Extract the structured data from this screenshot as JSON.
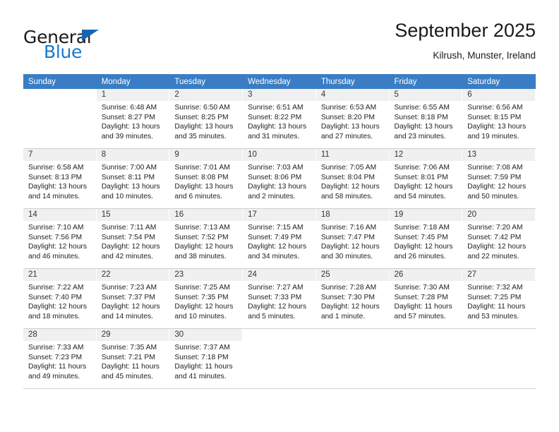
{
  "logo": {
    "word_one": "General",
    "word_two": "Blue",
    "triangle_color": "#1565b0",
    "blue_color": "#1878cf"
  },
  "header": {
    "month_title": "September 2025",
    "location": "Kilrush, Munster, Ireland"
  },
  "calendar": {
    "header_bg": "#3a7dc4",
    "daynum_bg": "#f0f0f0",
    "weekday_headers": [
      "Sunday",
      "Monday",
      "Tuesday",
      "Wednesday",
      "Thursday",
      "Friday",
      "Saturday"
    ],
    "weeks": [
      [
        {
          "day": "",
          "sunrise": "",
          "sunset": "",
          "daylight": ""
        },
        {
          "day": "1",
          "sunrise": "Sunrise: 6:48 AM",
          "sunset": "Sunset: 8:27 PM",
          "daylight": "Daylight: 13 hours and 39 minutes."
        },
        {
          "day": "2",
          "sunrise": "Sunrise: 6:50 AM",
          "sunset": "Sunset: 8:25 PM",
          "daylight": "Daylight: 13 hours and 35 minutes."
        },
        {
          "day": "3",
          "sunrise": "Sunrise: 6:51 AM",
          "sunset": "Sunset: 8:22 PM",
          "daylight": "Daylight: 13 hours and 31 minutes."
        },
        {
          "day": "4",
          "sunrise": "Sunrise: 6:53 AM",
          "sunset": "Sunset: 8:20 PM",
          "daylight": "Daylight: 13 hours and 27 minutes."
        },
        {
          "day": "5",
          "sunrise": "Sunrise: 6:55 AM",
          "sunset": "Sunset: 8:18 PM",
          "daylight": "Daylight: 13 hours and 23 minutes."
        },
        {
          "day": "6",
          "sunrise": "Sunrise: 6:56 AM",
          "sunset": "Sunset: 8:15 PM",
          "daylight": "Daylight: 13 hours and 19 minutes."
        }
      ],
      [
        {
          "day": "7",
          "sunrise": "Sunrise: 6:58 AM",
          "sunset": "Sunset: 8:13 PM",
          "daylight": "Daylight: 13 hours and 14 minutes."
        },
        {
          "day": "8",
          "sunrise": "Sunrise: 7:00 AM",
          "sunset": "Sunset: 8:11 PM",
          "daylight": "Daylight: 13 hours and 10 minutes."
        },
        {
          "day": "9",
          "sunrise": "Sunrise: 7:01 AM",
          "sunset": "Sunset: 8:08 PM",
          "daylight": "Daylight: 13 hours and 6 minutes."
        },
        {
          "day": "10",
          "sunrise": "Sunrise: 7:03 AM",
          "sunset": "Sunset: 8:06 PM",
          "daylight": "Daylight: 13 hours and 2 minutes."
        },
        {
          "day": "11",
          "sunrise": "Sunrise: 7:05 AM",
          "sunset": "Sunset: 8:04 PM",
          "daylight": "Daylight: 12 hours and 58 minutes."
        },
        {
          "day": "12",
          "sunrise": "Sunrise: 7:06 AM",
          "sunset": "Sunset: 8:01 PM",
          "daylight": "Daylight: 12 hours and 54 minutes."
        },
        {
          "day": "13",
          "sunrise": "Sunrise: 7:08 AM",
          "sunset": "Sunset: 7:59 PM",
          "daylight": "Daylight: 12 hours and 50 minutes."
        }
      ],
      [
        {
          "day": "14",
          "sunrise": "Sunrise: 7:10 AM",
          "sunset": "Sunset: 7:56 PM",
          "daylight": "Daylight: 12 hours and 46 minutes."
        },
        {
          "day": "15",
          "sunrise": "Sunrise: 7:11 AM",
          "sunset": "Sunset: 7:54 PM",
          "daylight": "Daylight: 12 hours and 42 minutes."
        },
        {
          "day": "16",
          "sunrise": "Sunrise: 7:13 AM",
          "sunset": "Sunset: 7:52 PM",
          "daylight": "Daylight: 12 hours and 38 minutes."
        },
        {
          "day": "17",
          "sunrise": "Sunrise: 7:15 AM",
          "sunset": "Sunset: 7:49 PM",
          "daylight": "Daylight: 12 hours and 34 minutes."
        },
        {
          "day": "18",
          "sunrise": "Sunrise: 7:16 AM",
          "sunset": "Sunset: 7:47 PM",
          "daylight": "Daylight: 12 hours and 30 minutes."
        },
        {
          "day": "19",
          "sunrise": "Sunrise: 7:18 AM",
          "sunset": "Sunset: 7:45 PM",
          "daylight": "Daylight: 12 hours and 26 minutes."
        },
        {
          "day": "20",
          "sunrise": "Sunrise: 7:20 AM",
          "sunset": "Sunset: 7:42 PM",
          "daylight": "Daylight: 12 hours and 22 minutes."
        }
      ],
      [
        {
          "day": "21",
          "sunrise": "Sunrise: 7:22 AM",
          "sunset": "Sunset: 7:40 PM",
          "daylight": "Daylight: 12 hours and 18 minutes."
        },
        {
          "day": "22",
          "sunrise": "Sunrise: 7:23 AM",
          "sunset": "Sunset: 7:37 PM",
          "daylight": "Daylight: 12 hours and 14 minutes."
        },
        {
          "day": "23",
          "sunrise": "Sunrise: 7:25 AM",
          "sunset": "Sunset: 7:35 PM",
          "daylight": "Daylight: 12 hours and 10 minutes."
        },
        {
          "day": "24",
          "sunrise": "Sunrise: 7:27 AM",
          "sunset": "Sunset: 7:33 PM",
          "daylight": "Daylight: 12 hours and 5 minutes."
        },
        {
          "day": "25",
          "sunrise": "Sunrise: 7:28 AM",
          "sunset": "Sunset: 7:30 PM",
          "daylight": "Daylight: 12 hours and 1 minute."
        },
        {
          "day": "26",
          "sunrise": "Sunrise: 7:30 AM",
          "sunset": "Sunset: 7:28 PM",
          "daylight": "Daylight: 11 hours and 57 minutes."
        },
        {
          "day": "27",
          "sunrise": "Sunrise: 7:32 AM",
          "sunset": "Sunset: 7:25 PM",
          "daylight": "Daylight: 11 hours and 53 minutes."
        }
      ],
      [
        {
          "day": "28",
          "sunrise": "Sunrise: 7:33 AM",
          "sunset": "Sunset: 7:23 PM",
          "daylight": "Daylight: 11 hours and 49 minutes."
        },
        {
          "day": "29",
          "sunrise": "Sunrise: 7:35 AM",
          "sunset": "Sunset: 7:21 PM",
          "daylight": "Daylight: 11 hours and 45 minutes."
        },
        {
          "day": "30",
          "sunrise": "Sunrise: 7:37 AM",
          "sunset": "Sunset: 7:18 PM",
          "daylight": "Daylight: 11 hours and 41 minutes."
        },
        {
          "day": "",
          "sunrise": "",
          "sunset": "",
          "daylight": ""
        },
        {
          "day": "",
          "sunrise": "",
          "sunset": "",
          "daylight": ""
        },
        {
          "day": "",
          "sunrise": "",
          "sunset": "",
          "daylight": ""
        },
        {
          "day": "",
          "sunrise": "",
          "sunset": "",
          "daylight": ""
        }
      ]
    ]
  }
}
